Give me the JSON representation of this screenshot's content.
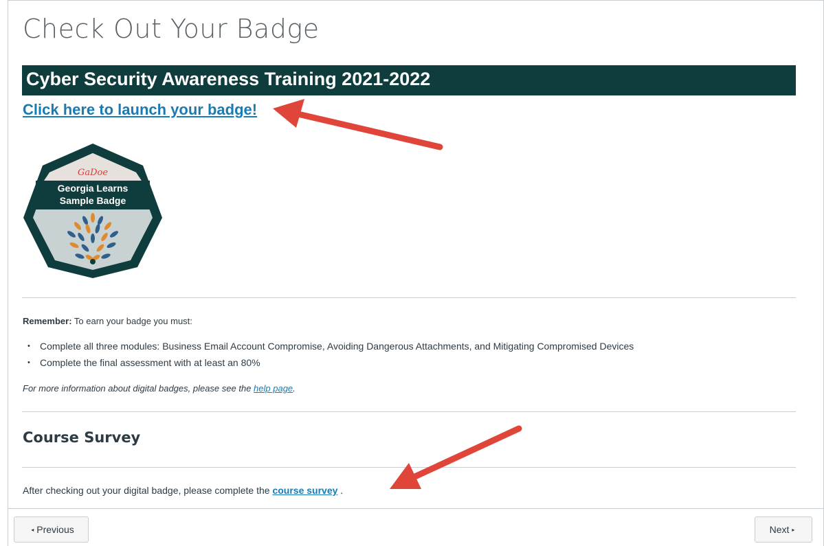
{
  "page": {
    "title": "Check Out Your Badge"
  },
  "banner": {
    "title": "Cyber Security Awareness Training 2021-2022"
  },
  "launch_link": "Click here to launch your badge!",
  "badge": {
    "logo_text": "GaDoe",
    "line1": "Georgia Learns",
    "line2": "Sample Badge",
    "colors": {
      "frame": "#0f3c3c",
      "fill": "#c9d2d2",
      "top_band": "#e7e1de",
      "logo": "#d8413a",
      "leaf_blue": "#2f5f8a",
      "leaf_orange": "#e08a2e"
    }
  },
  "requirements": {
    "remember_label": "Remember:",
    "intro": " To earn your badge you must:",
    "items": [
      "Complete all three modules: Business Email Account Compromise, Avoiding Dangerous Attachments, and Mitigating Compromised Devices",
      "Complete the final assessment with at least an 80%"
    ],
    "more_info_prefix": "For more information about digital badges, please see the ",
    "help_link": "help page",
    "more_info_suffix": "."
  },
  "survey": {
    "heading": "Course Survey",
    "text_prefix": "After checking out your digital badge, please complete the ",
    "link": "course survey",
    "text_suffix": " ."
  },
  "nav": {
    "previous": "Previous",
    "next": "Next",
    "prev_icon": "◂",
    "next_icon": "▸"
  },
  "colors": {
    "banner_bg": "#0f3c3c",
    "link": "#1a7bb4",
    "annotation_arrow": "#e0453a"
  }
}
